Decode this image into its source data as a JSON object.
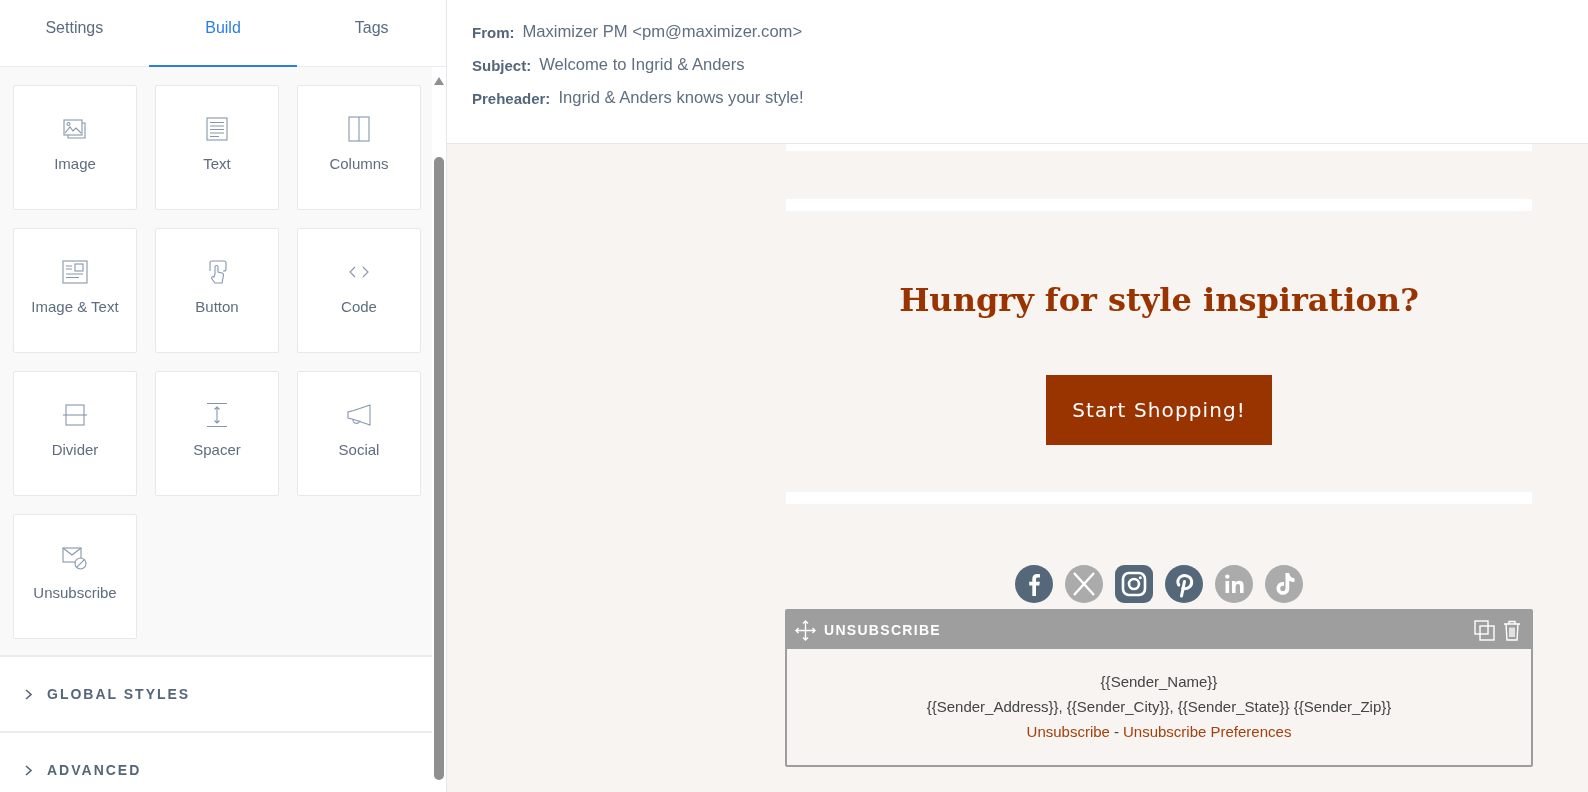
{
  "sidebar": {
    "tabs": [
      {
        "label": "Settings",
        "selected": false
      },
      {
        "label": "Build",
        "selected": true
      },
      {
        "label": "Tags",
        "selected": false
      }
    ],
    "blocks": [
      {
        "label": "Image",
        "kind": "image"
      },
      {
        "label": "Text",
        "kind": "text"
      },
      {
        "label": "Columns",
        "kind": "columns"
      },
      {
        "label": "Image & Text",
        "kind": "image_text"
      },
      {
        "label": "Button",
        "kind": "button"
      },
      {
        "label": "Code",
        "kind": "code"
      },
      {
        "label": "Divider",
        "kind": "divider"
      },
      {
        "label": "Spacer",
        "kind": "spacer"
      },
      {
        "label": "Social",
        "kind": "social"
      },
      {
        "label": "Unsubscribe",
        "kind": "unsubscribe"
      }
    ],
    "sections": [
      {
        "label": "GLOBAL STYLES",
        "expanded": false
      },
      {
        "label": "ADVANCED",
        "expanded": false
      }
    ]
  },
  "email_header": {
    "fields": [
      {
        "label": "From:",
        "value": "Maximizer PM <pm@maximizer.com>"
      },
      {
        "label": "Subject:",
        "value": "Welcome to Ingrid & Anders"
      },
      {
        "label": "Preheader:",
        "value": "Ingrid & Anders knows your style!"
      }
    ]
  },
  "canvas": {
    "heading": "Hungry for style inspiration?",
    "button": {
      "label": "Start Shopping!"
    },
    "social_icons": [
      {
        "kind": "facebook",
        "color": "#546879"
      },
      {
        "kind": "x",
        "color": "#ababab"
      },
      {
        "kind": "instagram",
        "color": "#546879"
      },
      {
        "kind": "pinterest",
        "color": "#546879"
      },
      {
        "kind": "linkedin",
        "color": "#ababab"
      },
      {
        "kind": "tiktok",
        "color": "#ababab"
      }
    ],
    "unsubscribe_block": {
      "title": "UNSUBSCRIBE",
      "lines": [
        "{{Sender_Name}}",
        "{{Sender_Address}}, {{Sender_City}}, {{Sender_State}} {{Sender_Zip}}"
      ],
      "links": [
        "Unsubscribe",
        "Unsubscribe Preferences"
      ],
      "link_separator": "-"
    }
  }
}
